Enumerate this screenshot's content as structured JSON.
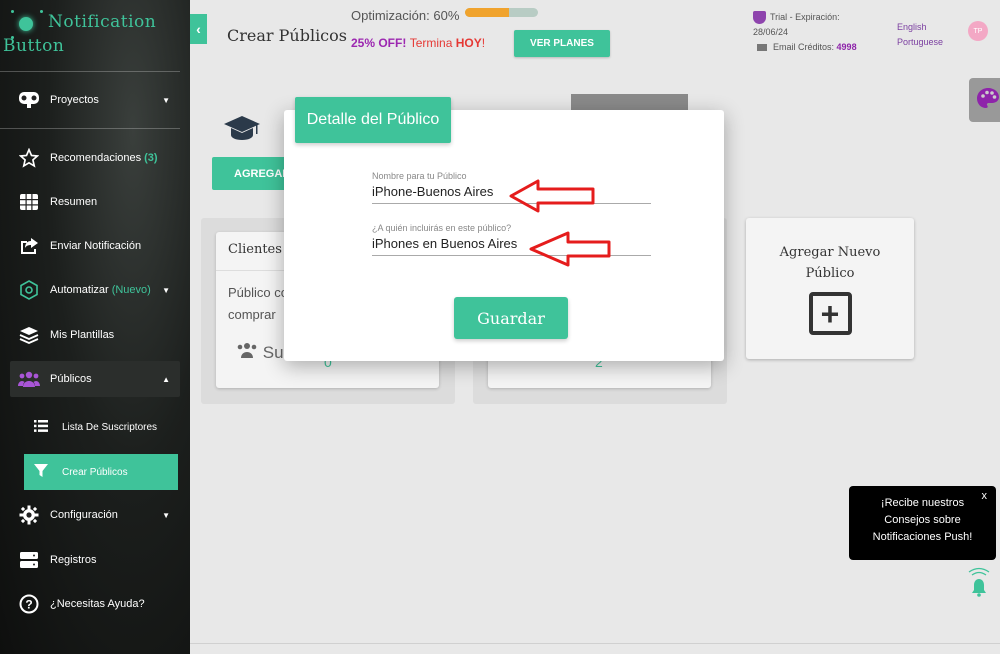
{
  "app": {
    "logo_line1": "Notification",
    "logo_line2": "Button"
  },
  "sidebar": {
    "items": [
      {
        "label": "Proyectos"
      },
      {
        "label": "Recomendaciones",
        "count": "(3)"
      },
      {
        "label": "Resumen"
      },
      {
        "label": "Enviar Notificación"
      },
      {
        "label": "Automatizar",
        "tag": "(Nuevo)"
      },
      {
        "label": "Mis Plantillas"
      },
      {
        "label": "Públicos"
      },
      {
        "label": "Configuración"
      },
      {
        "label": "Registros"
      },
      {
        "label": "¿Necesitas Ayuda?"
      }
    ],
    "subitems": [
      {
        "label": "Lista De Suscriptores"
      },
      {
        "label": "Crear Públicos"
      }
    ]
  },
  "header": {
    "title": "Crear Públicos",
    "optimization_label": "Optimización: 60%",
    "optimization_value": 60,
    "promo_off": "25% OFF!",
    "promo_termina": "Termina",
    "promo_hoy": "HOY",
    "promo_bang": "!",
    "plans_button": "VER PLANES",
    "trial_line1": "Trial - Expiración:",
    "trial_line2": "28/06/24",
    "email_credits_label": "Email Créditos:",
    "email_credits_value": "4998",
    "lang_en": "English",
    "lang_pt": "Portuguese",
    "avatar_initials": "TP"
  },
  "background": {
    "add_button": "AGREGAR",
    "card1_title": "Clientes P",
    "card1_desc": "Público co comprar",
    "card1_users": "Su",
    "card1_count": "0",
    "card2_count": "2",
    "new_card_line1": "Agregar Nuevo",
    "new_card_line2": "Público"
  },
  "modal": {
    "title": "Detalle del Público",
    "name_label": "Nombre para tu Público",
    "name_value": "iPhone-Buenos Aires",
    "who_label": "¿A quién incluirás en este público?",
    "who_value": "iPhones en Buenos Aires",
    "save_button": "Guardar"
  },
  "push_tip": {
    "close": "x",
    "line1": "¡Recibe nuestros",
    "line2": "Consejos sobre",
    "line3": "Notificaciones Push!"
  },
  "colors": {
    "accent": "#3fc39a",
    "promo_purple": "#9c27b0",
    "promo_red": "#e53935",
    "arrow_red": "#e51c1c"
  }
}
